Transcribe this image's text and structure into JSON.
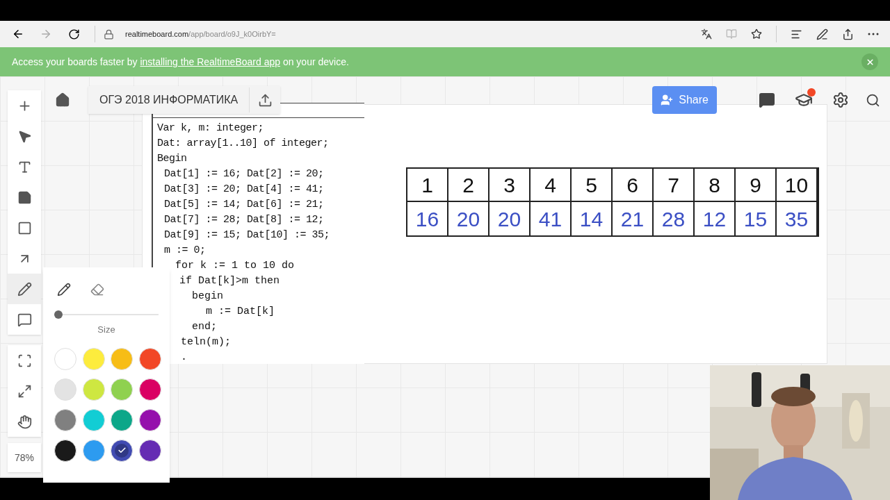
{
  "browser": {
    "url_host": "realtimeboard.com",
    "url_path": "/app/board/o9J_k0OirbY="
  },
  "banner": {
    "before": "Access your boards faster by ",
    "link": "installing the RealtimeBoard app",
    "after": " on your device."
  },
  "board": {
    "title": "ОГЭ 2018 ИНФОРМАТИКА",
    "share": "Share",
    "notification": true
  },
  "toolbar": [
    {
      "kind": "add",
      "selected": false
    },
    {
      "kind": "select",
      "selected": false
    },
    {
      "kind": "text",
      "selected": false
    },
    {
      "kind": "sticky",
      "selected": false
    },
    {
      "kind": "shape",
      "selected": false
    },
    {
      "kind": "arrow",
      "selected": false
    },
    {
      "kind": "pen",
      "selected": true
    },
    {
      "kind": "comment",
      "selected": false
    }
  ],
  "view_tools": [
    {
      "kind": "frame"
    },
    {
      "kind": "fit"
    },
    {
      "kind": "hand"
    }
  ],
  "zoom": "78%",
  "pen_panel": {
    "tools": [
      {
        "kind": "pen",
        "selected": true
      },
      {
        "kind": "eraser",
        "selected": false
      }
    ],
    "size": {
      "level": 0
    },
    "size_label": "Size",
    "colors": [
      {
        "color": "#ffffff",
        "selected": false
      },
      {
        "color": "#fdec3d",
        "selected": false
      },
      {
        "color": "#f7bd16",
        "selected": false
      },
      {
        "color": "#f24726",
        "selected": false
      },
      {
        "color": "#e3e3e3",
        "selected": false
      },
      {
        "color": "#cee741",
        "selected": false
      },
      {
        "color": "#8fd14f",
        "selected": false
      },
      {
        "color": "#da0063",
        "selected": false
      },
      {
        "color": "#808080",
        "selected": false
      },
      {
        "color": "#12cdd4",
        "selected": false
      },
      {
        "color": "#0ca789",
        "selected": false
      },
      {
        "color": "#9510ac",
        "selected": false
      },
      {
        "color": "#1a1a1a",
        "selected": false
      },
      {
        "color": "#2d9bf0",
        "selected": false
      },
      {
        "color": "#414bb2",
        "selected": true
      },
      {
        "color": "#652cb3",
        "selected": false
      }
    ]
  },
  "code": {
    "lines": [
      {
        "text": "Var k, m: integer;",
        "indent": false
      },
      {
        "text": "Dat: array[1..10] of integer;",
        "indent": false
      },
      {
        "text": "Begin",
        "indent": false
      },
      {
        "text": "Dat[1] := 16; Dat[2] := 20;",
        "indent": true
      },
      {
        "text": "Dat[3] := 20; Dat[4] := 41;",
        "indent": true
      },
      {
        "text": "Dat[5] := 14; Dat[6] := 21;",
        "indent": true
      },
      {
        "text": "Dat[7] := 28; Dat[8] := 12;",
        "indent": true
      },
      {
        "text": "Dat[9] := 15; Dat[10] := 35;",
        "indent": true
      },
      {
        "text": "m := 0;",
        "indent": true
      }
    ],
    "covered_lines": [
      "for k := 1 to 10 do",
      "if  Dat[k]>m then",
      "begin",
      "m := Dat[k]",
      "end;",
      "teln(m);",
      "."
    ]
  },
  "table": {
    "indexes": [
      "1",
      "2",
      "3",
      "4",
      "5",
      "6",
      "7",
      "8",
      "9",
      "10"
    ],
    "values": [
      "16",
      "20",
      "20",
      "41",
      "14",
      "21",
      "28",
      "12",
      "15",
      "35"
    ]
  }
}
